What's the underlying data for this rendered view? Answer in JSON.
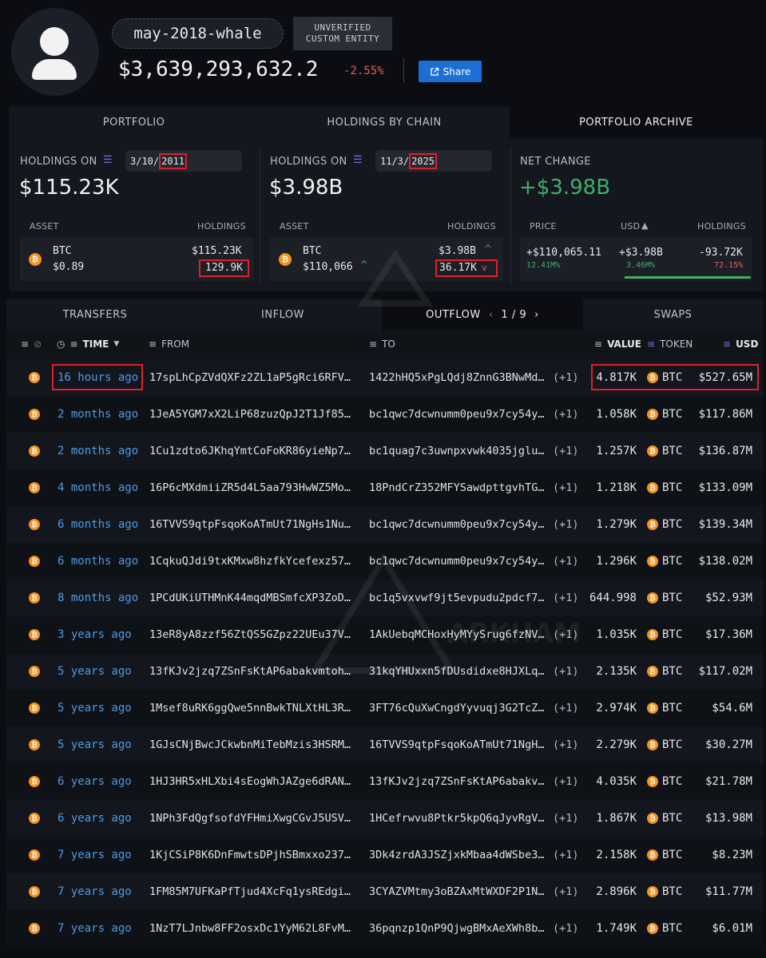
{
  "entity": {
    "name": "may-2018-whale",
    "badge_line1": "UNVERIFIED",
    "badge_line2": "CUSTOM ENTITY",
    "total_value": "$3,639,293,632.2",
    "change_pct": "-2.55%",
    "share_label": "Share"
  },
  "panel_tabs": [
    "PORTFOLIO",
    "HOLDINGS BY CHAIN",
    "PORTFOLIO ARCHIVE"
  ],
  "archive_left": {
    "label": "HOLDINGS ON",
    "date_prefix": "3/10/",
    "date_year": "2011",
    "total": "$115.23K",
    "col_asset": "ASSET",
    "col_holdings": "HOLDINGS",
    "asset": "BTC",
    "price": "$0.89",
    "usd": "$115.23K",
    "amount": "129.9K"
  },
  "archive_right": {
    "label": "HOLDINGS ON",
    "date_prefix": "11/3/",
    "date_year": "2025",
    "total": "$3.98B",
    "col_asset": "ASSET",
    "col_holdings": "HOLDINGS",
    "asset": "BTC",
    "price": "$110,066",
    "usd": "$3.98B",
    "amount": "36.17K"
  },
  "net_change": {
    "label": "NET CHANGE",
    "value": "+$3.98B",
    "col_price": "PRICE",
    "col_usd": "USD",
    "col_holdings": "HOLDINGS",
    "price_change": "+$110,065.11",
    "price_pct": "12.41M%",
    "usd_change": "+$3.98B",
    "usd_pct": "3.46M%",
    "holdings_change": "-93.72K",
    "holdings_pct": "72.15%"
  },
  "table_tabs": {
    "transfers": "TRANSFERS",
    "inflow": "INFLOW",
    "outflow": "OUTFLOW",
    "page": "1 / 9",
    "swaps": "SWAPS"
  },
  "columns": {
    "time": "TIME",
    "from": "FROM",
    "to": "TO",
    "value": "VALUE",
    "token": "TOKEN",
    "usd": "USD"
  },
  "rows": [
    {
      "time": "16 hours ago",
      "from": "17spLhCpZVdQXFz2ZL1aP5gRci6RFV…",
      "to": "1422hHQ5xPgLQdj8ZnnG3BNwMd…",
      "plus": "(+1)",
      "value": "4.817K",
      "token": "BTC",
      "usd": "$527.65M"
    },
    {
      "time": "2 months ago",
      "from": "1JeA5YGM7xX2LiP68zuzQpJ2T1Jf85…",
      "to": "bc1qwc7dcwnumm0peu9x7cy54y…",
      "plus": "(+1)",
      "value": "1.058K",
      "token": "BTC",
      "usd": "$117.86M"
    },
    {
      "time": "2 months ago",
      "from": "1Cu1zdto6JKhqYmtCoFoKR86yieNp7…",
      "to": "bc1quag7c3uwnpxvwk4035jglu…",
      "plus": "(+1)",
      "value": "1.257K",
      "token": "BTC",
      "usd": "$136.87M"
    },
    {
      "time": "4 months ago",
      "from": "16P6cMXdmiiZR5d4L5aa793HwWZ5Mo…",
      "to": "18PndCrZ352MFYSawdpttgvhTG…",
      "plus": "(+1)",
      "value": "1.218K",
      "token": "BTC",
      "usd": "$133.09M"
    },
    {
      "time": "6 months ago",
      "from": "16TVVS9qtpFsqoKoATmUt71NgHs1Nu…",
      "to": "bc1qwc7dcwnumm0peu9x7cy54y…",
      "plus": "(+1)",
      "value": "1.279K",
      "token": "BTC",
      "usd": "$139.34M"
    },
    {
      "time": "6 months ago",
      "from": "1CqkuQJdi9txKMxw8hzfkYcefexz57…",
      "to": "bc1qwc7dcwnumm0peu9x7cy54y…",
      "plus": "(+1)",
      "value": "1.296K",
      "token": "BTC",
      "usd": "$138.02M"
    },
    {
      "time": "8 months ago",
      "from": "1PCdUKiUTHMnK44mqdMBSmfcXP3ZoD…",
      "to": "bc1q5vxvwf9jt5evpudu2pdcf7…",
      "plus": "(+1)",
      "value": "644.998",
      "token": "BTC",
      "usd": "$52.93M"
    },
    {
      "time": "3 years ago",
      "from": "13eR8yA8zzf56ZtQS5GZpz22UEu37V…",
      "to": "1AkUebqMCHoxHyMYySrug6fzNV…",
      "plus": "(+1)",
      "value": "1.035K",
      "token": "BTC",
      "usd": "$17.36M"
    },
    {
      "time": "5 years ago",
      "from": "13fKJv2jzq7ZSnFsKtAP6abakvmtoh…",
      "to": "31kqYHUxxn5fDUsdidxe8HJXLq…",
      "plus": "(+1)",
      "value": "2.135K",
      "token": "BTC",
      "usd": "$117.02M"
    },
    {
      "time": "5 years ago",
      "from": "1Msef8uRK6ggQwe5nnBwkTNLXtHL3R…",
      "to": "3FT76cQuXwCngdYyvuqj3G2TcZ…",
      "plus": "(+1)",
      "value": "2.974K",
      "token": "BTC",
      "usd": "$54.6M"
    },
    {
      "time": "5 years ago",
      "from": "1GJsCNjBwcJCkwbnMiTebMzis3HSRM…",
      "to": "16TVVS9qtpFsqoKoATmUt71NgH…",
      "plus": "(+1)",
      "value": "2.279K",
      "token": "BTC",
      "usd": "$30.27M"
    },
    {
      "time": "6 years ago",
      "from": "1HJ3HR5xHLXbi4sEogWhJAZge6dRAN…",
      "to": "13fKJv2jzq7ZSnFsKtAP6abakv…",
      "plus": "(+1)",
      "value": "4.035K",
      "token": "BTC",
      "usd": "$21.78M"
    },
    {
      "time": "6 years ago",
      "from": "1NPh3FdQgfsofdYFHmiXwgCGvJ5USV…",
      "to": "1HCefrwvu8Ptkr5kpQ6qJyvRgV…",
      "plus": "(+1)",
      "value": "1.867K",
      "token": "BTC",
      "usd": "$13.98M"
    },
    {
      "time": "7 years ago",
      "from": "1KjCSiP8K6DnFmwtsDPjhSBmxxo237…",
      "to": "3Dk4zrdA3JSZjxkMbaa4dWSbe3…",
      "plus": "(+1)",
      "value": "2.158K",
      "token": "BTC",
      "usd": "$8.23M"
    },
    {
      "time": "7 years ago",
      "from": "1FM85M7UFKaPfTjud4XcFq1ysREdgi…",
      "to": "3CYAZVMtmy3oBZAxMtWXDF2P1N…",
      "plus": "(+1)",
      "value": "2.896K",
      "token": "BTC",
      "usd": "$11.77M"
    },
    {
      "time": "7 years ago",
      "from": "1NzT7LJnbw8FF2osxDc1YyM62L8FvM…",
      "to": "36pqnzp1QnP9QjwgBMxAeXWh8b…",
      "plus": "(+1)",
      "value": "1.749K",
      "token": "BTC",
      "usd": "$6.01M"
    }
  ],
  "colors": {
    "accent": "#1d6fd6",
    "positive": "#3fb06a",
    "negative": "#e0605e",
    "btc": "#f39321",
    "highlight": "#e0202a",
    "link": "#4d9be8"
  }
}
